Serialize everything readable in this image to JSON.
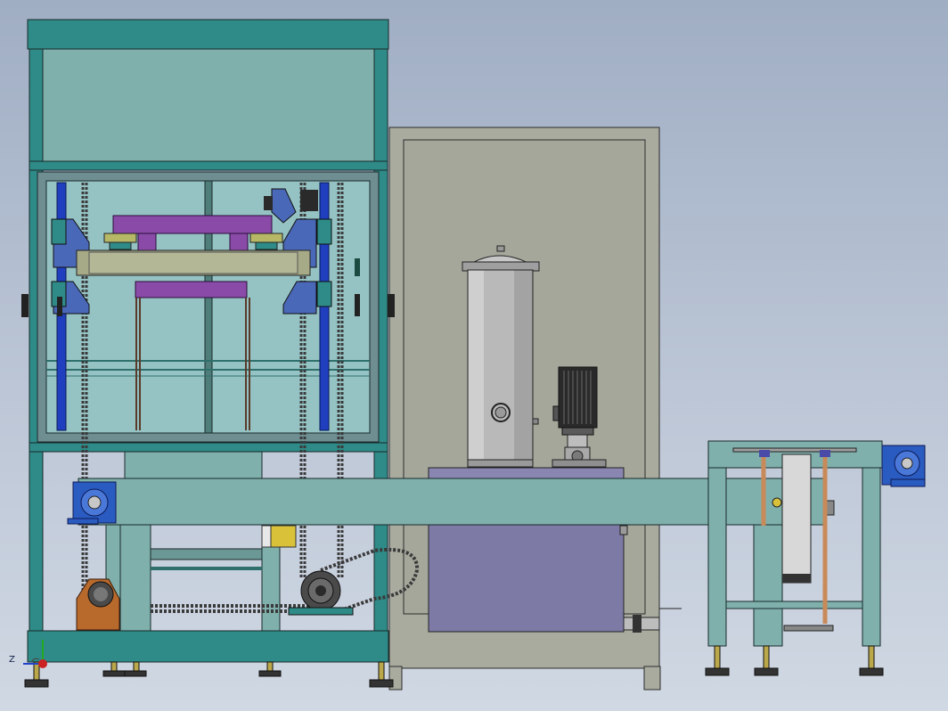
{
  "view": {
    "triad_label": "Z",
    "colors": {
      "frame": "#2f8b88",
      "panel": "#7fb0ac",
      "glass": "#95c3c4",
      "cabinet": "#a9ab9f",
      "tank": "#b9b9b9",
      "motor": "#2a2a2a",
      "gearbox": "#2a5bc0",
      "purple": "#8a4aa8",
      "blue_rail": "#1f3fbf",
      "reservoir": "#7d7aa6",
      "brown": "#b86a2c",
      "yellow": "#d9c23a",
      "chain": "#3a3a3a",
      "copper": "#c98a5a"
    }
  }
}
